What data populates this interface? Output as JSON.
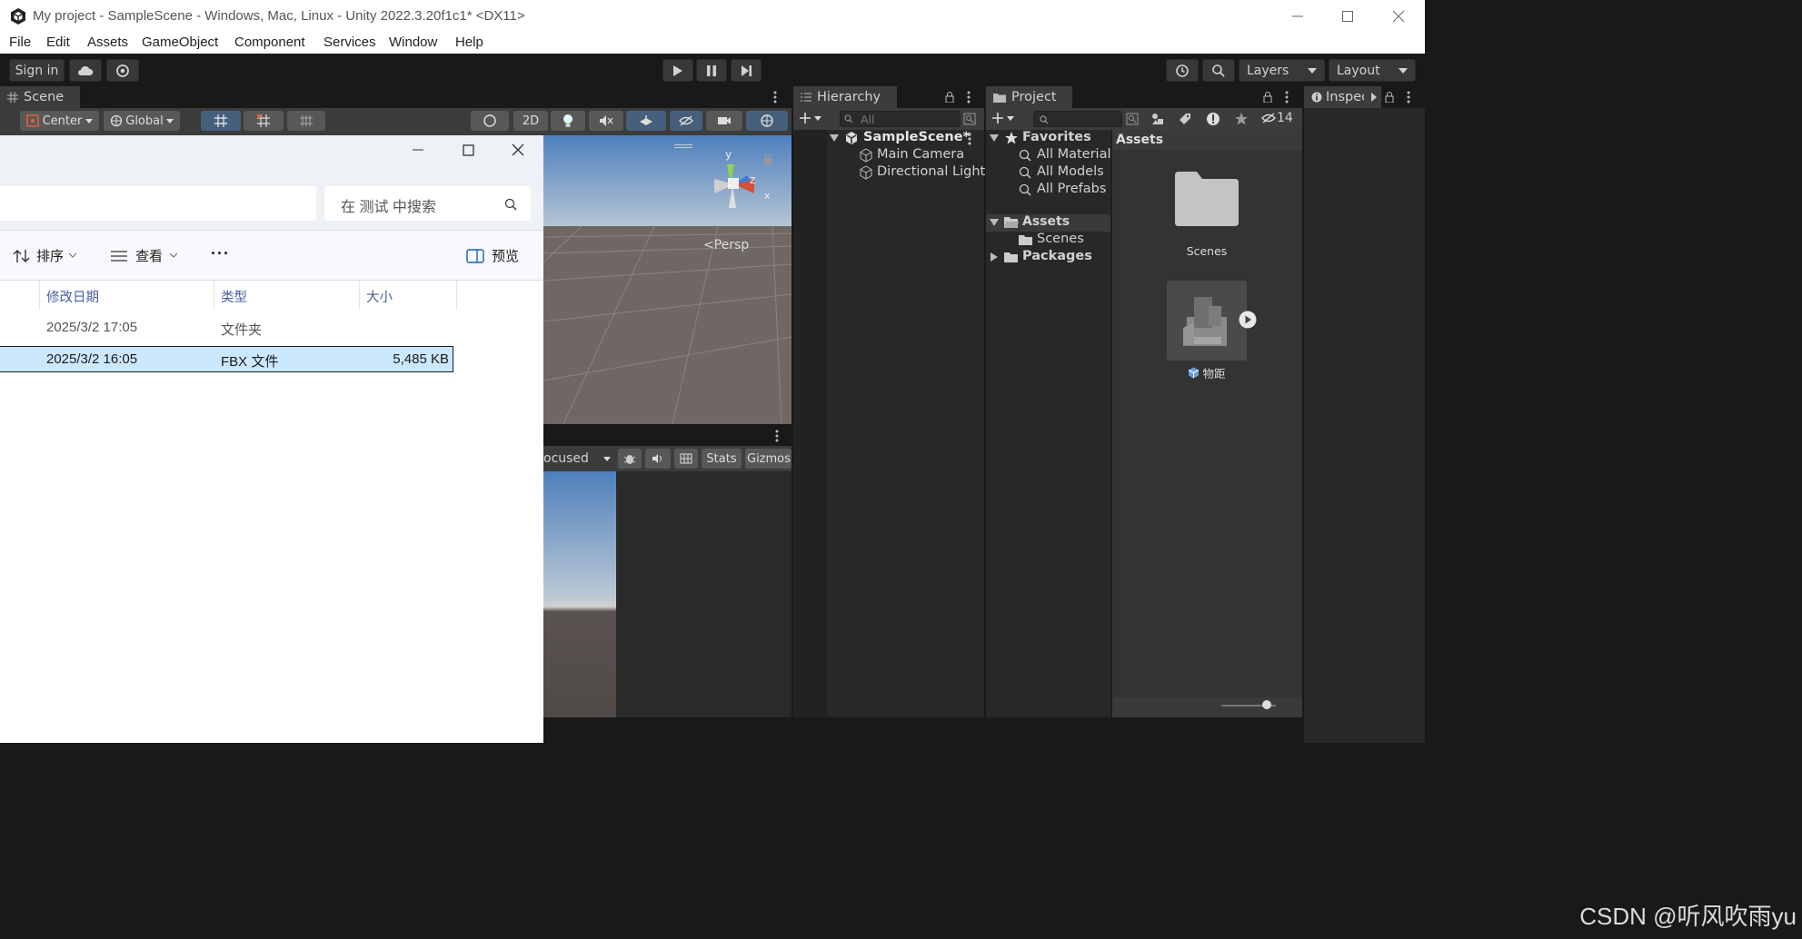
{
  "window": {
    "title": "My project - SampleScene - Windows, Mac, Linux - Unity 2022.3.20f1c1* <DX11>"
  },
  "menu": [
    "File",
    "Edit",
    "Assets",
    "GameObject",
    "Component",
    "Services",
    "Window",
    "Help"
  ],
  "toolbar": {
    "sign_in": "Sign in",
    "layers": "Layers",
    "layout": "Layout"
  },
  "scene": {
    "tab": "Scene",
    "pivot": "Center",
    "space": "Global",
    "mode_2d": "2D",
    "persp": "Persp",
    "gizmo_axes": {
      "y": "y",
      "z": "z",
      "x": "x"
    }
  },
  "game": {
    "focus": "ocused",
    "stats": "Stats",
    "gizmos": "Gizmos"
  },
  "hierarchy": {
    "tab": "Hierarchy",
    "search_placeholder": "All",
    "scene": "SampleScene*",
    "items": [
      "Main Camera",
      "Directional Light"
    ]
  },
  "project": {
    "tab": "Project",
    "hidden_count": "14",
    "favorites": "Favorites",
    "fav_items": [
      "All Materials",
      "All Models",
      "All Prefabs"
    ],
    "assets": "Assets",
    "scenes": "Scenes",
    "packages": "Packages",
    "grid_header": "Assets",
    "grid_items": [
      {
        "label": "Scenes",
        "type": "folder"
      },
      {
        "label": "物距",
        "type": "model"
      }
    ]
  },
  "inspector": {
    "tab": "Inspector"
  },
  "explorer": {
    "search_placeholder": "在 测试 中搜索",
    "sort": "排序",
    "view": "查看",
    "more": "···",
    "preview": "预览",
    "columns": [
      "修改日期",
      "类型",
      "大小"
    ],
    "rows": [
      {
        "date": "2025/3/2 17:05",
        "type": "文件夹",
        "size": "",
        "selected": false
      },
      {
        "date": "2025/3/2 16:05",
        "type": "FBX 文件",
        "size": "5,485 KB",
        "selected": true
      }
    ]
  },
  "watermark": "CSDN @听风吹雨yu",
  "colors": {
    "selection": "#cce8ff",
    "selection_border": "#1a1a1a",
    "sky_top": "#4e80bf",
    "ground": "#6e6763",
    "active_button": "#46607c"
  }
}
